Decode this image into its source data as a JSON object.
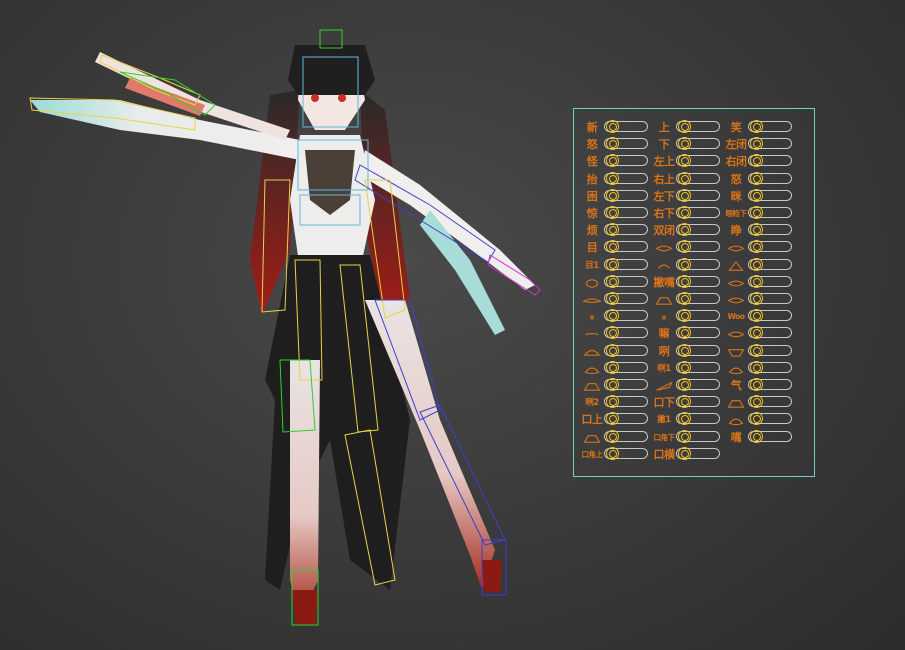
{
  "panel": {
    "columns": [
      [
        {
          "label": "新",
          "shape": null
        },
        {
          "label": "怒",
          "shape": null
        },
        {
          "label": "怪",
          "shape": null
        },
        {
          "label": "抬",
          "shape": null
        },
        {
          "label": "困",
          "shape": null
        },
        {
          "label": "惊",
          "shape": null
        },
        {
          "label": "烦",
          "shape": null
        },
        {
          "label": "目",
          "shape": null
        },
        {
          "label": "目1",
          "shape": null
        },
        {
          "label": "",
          "shape": "blob"
        },
        {
          "label": "",
          "shape": "flat"
        },
        {
          "label": "",
          "shape": "dot"
        },
        {
          "label": "",
          "shape": "line"
        },
        {
          "label": "",
          "shape": "arch"
        },
        {
          "label": "",
          "shape": "round"
        },
        {
          "label": "",
          "shape": "mound"
        },
        {
          "label": "咧2",
          "shape": null
        },
        {
          "label": "口上",
          "shape": null
        },
        {
          "label": "",
          "shape": "mound"
        },
        {
          "label": "口角上",
          "shape": null
        }
      ],
      [
        {
          "label": "上",
          "shape": null
        },
        {
          "label": "下",
          "shape": null
        },
        {
          "label": "左上",
          "shape": null
        },
        {
          "label": "右上",
          "shape": null
        },
        {
          "label": "左下",
          "shape": null
        },
        {
          "label": "右下",
          "shape": null
        },
        {
          "label": "双闭",
          "shape": null
        },
        {
          "label": "",
          "shape": "lens"
        },
        {
          "label": "",
          "shape": "arc"
        },
        {
          "label": "撇嘴",
          "shape": null
        },
        {
          "label": "",
          "shape": "mound"
        },
        {
          "label": "",
          "shape": "dot"
        },
        {
          "label": "嘛",
          "shape": null
        },
        {
          "label": "咧",
          "shape": null
        },
        {
          "label": "咧1",
          "shape": null
        },
        {
          "label": "",
          "shape": "wedge"
        },
        {
          "label": "口下",
          "shape": null
        },
        {
          "label": "撇1",
          "shape": null
        },
        {
          "label": "口角下",
          "shape": null
        },
        {
          "label": "口横",
          "shape": null
        }
      ],
      [
        {
          "label": "笑",
          "shape": null
        },
        {
          "label": "左闭",
          "shape": null
        },
        {
          "label": "右闭",
          "shape": null
        },
        {
          "label": "怒",
          "shape": null
        },
        {
          "label": "眯",
          "shape": null
        },
        {
          "label": "眼睑下",
          "shape": null
        },
        {
          "label": "睁",
          "shape": null
        },
        {
          "label": "",
          "shape": "lens"
        },
        {
          "label": "",
          "shape": "peak"
        },
        {
          "label": "",
          "shape": "lens"
        },
        {
          "label": "",
          "shape": "lens"
        },
        {
          "label": "Woo",
          "shape": null
        },
        {
          "label": "",
          "shape": "lens"
        },
        {
          "label": "",
          "shape": "cup"
        },
        {
          "label": "",
          "shape": "round"
        },
        {
          "label": "气",
          "shape": null
        },
        {
          "label": "",
          "shape": "mound"
        },
        {
          "label": "",
          "shape": "round"
        },
        {
          "label": "嘴",
          "shape": null
        }
      ]
    ]
  }
}
